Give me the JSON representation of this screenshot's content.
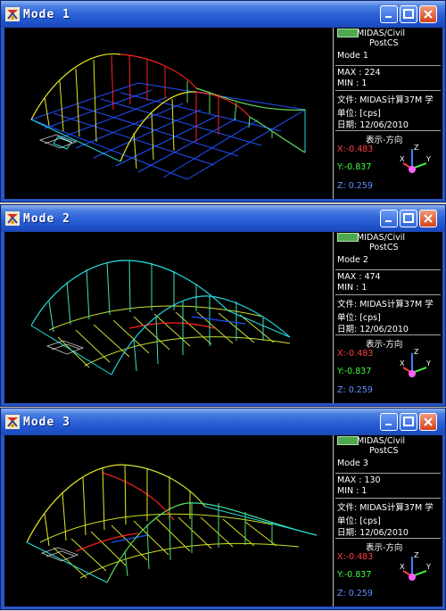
{
  "windows": [
    {
      "title": "Mode 1",
      "legend": {
        "product": "MIDAS/Civil",
        "postcs": "PostCS",
        "mode": "Mode 1",
        "max": "MAX : 224",
        "min": "MIN : 1",
        "file": "文件: MIDAS计算37M 学",
        "unit": "单位: [cps]",
        "date": "日期: 12/06/2010",
        "view_dir": "表示-方向",
        "x": "X:-0.483",
        "y": "Y:-0.837",
        "z": "Z: 0.259"
      }
    },
    {
      "title": "Mode 2",
      "legend": {
        "product": "MIDAS/Civil",
        "postcs": "PostCS",
        "mode": "Mode 2",
        "max": "MAX : 474",
        "min": "MIN : 1",
        "file": "文件: MIDAS计算37M 学",
        "unit": "单位: [cps]",
        "date": "日期: 12/06/2010",
        "view_dir": "表示-方向",
        "x": "X:-0.483",
        "y": "Y:-0.837",
        "z": "Z: 0.259"
      }
    },
    {
      "title": "Mode 3",
      "legend": {
        "product": "MIDAS/Civil",
        "postcs": "PostCS",
        "mode": "Mode 3",
        "max": "MAX : 130",
        "min": "MIN : 1",
        "file": "文件: MIDAS计算37M 学",
        "unit": "单位: [cps]",
        "date": "日期: 12/06/2010",
        "view_dir": "表示-方向",
        "x": "X:-0.483",
        "y": "Y:-0.837",
        "z": "Z: 0.259"
      }
    }
  ],
  "colors": {
    "titlebar": "#2c62d8",
    "axis_x": "#ff4040",
    "axis_y": "#40ff40",
    "axis_z": "#4080ff",
    "arch_red": "#ff2020",
    "arch_yellow": "#e8e820",
    "arch_green": "#60e060",
    "arch_cyan": "#20e0e0",
    "deck_blue": "#2050ff"
  },
  "icons": {
    "app": "midas-app-icon",
    "minimize": "minimize-icon",
    "maximize": "maximize-icon",
    "close": "close-icon",
    "axis": "axis-triad-icon"
  }
}
